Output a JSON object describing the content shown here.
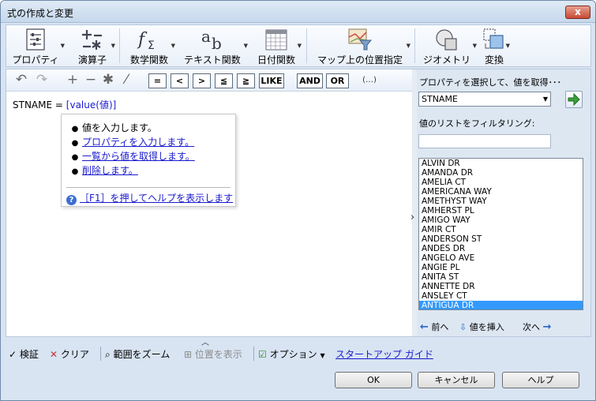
{
  "window": {
    "title": "式の作成と変更",
    "close": "x"
  },
  "ribbon": [
    {
      "id": "property",
      "label": "プロパティ",
      "icon": "property-list-icon"
    },
    {
      "id": "operator",
      "label": "演算子",
      "icon": "operator-icon"
    },
    {
      "id": "math",
      "label": "数学関数",
      "icon": "function-sigma-icon"
    },
    {
      "id": "text",
      "label": "テキスト関数",
      "icon": "text-function-icon"
    },
    {
      "id": "date",
      "label": "日付関数",
      "icon": "calendar-icon"
    },
    {
      "id": "maplocation",
      "label": "マップ上の位置指定",
      "icon": "map-filter-icon"
    },
    {
      "id": "geometry",
      "label": "ジオメトリ",
      "icon": "geometry-icon"
    },
    {
      "id": "transform",
      "label": "変換",
      "icon": "transform-icon"
    }
  ],
  "operators": [
    "=",
    "<",
    ">",
    "≦",
    "≧",
    "LIKE",
    "AND",
    "OR",
    "(…)"
  ],
  "editor": {
    "field": "STNAME",
    "op": "=",
    "token": "[value(値)]"
  },
  "popup": {
    "items": [
      {
        "text": "値を入力します。",
        "link": false
      },
      {
        "text": "プロパティを入力します。",
        "link": true
      },
      {
        "text": "一覧から値を取得します。",
        "link": true
      },
      {
        "text": "削除します。",
        "link": true
      }
    ],
    "help": "［F1］を押してヘルプを表示します"
  },
  "right": {
    "property_label": "プロパティを選択して、値を取得･･･",
    "property_value": "STNAME",
    "filter_label": "値のリストをフィルタリング:",
    "filter_value": "",
    "values": [
      "ALVIN DR",
      "AMANDA DR",
      "AMELIA CT",
      "AMERICANA WAY",
      "AMETHYST WAY",
      "AMHERST PL",
      "AMIGO WAY",
      "AMIR CT",
      "ANDERSON ST",
      "ANDES DR",
      "ANGELO AVE",
      "ANGIE PL",
      "ANITA ST",
      "ANNETTE DR",
      "ANSLEY CT",
      "ANTIGUA DR"
    ],
    "selected": 15,
    "prev": "前へ",
    "insert": "値を挿入",
    "next": "次へ"
  },
  "status": {
    "verify": "検証",
    "clear": "クリア",
    "zoom": "範囲をズーム",
    "showloc": "位置を表示",
    "options": "オプション",
    "guide": "スタートアップ ガイド"
  },
  "buttons": {
    "ok": "OK",
    "cancel": "キャンセル",
    "help": "ヘルプ"
  }
}
